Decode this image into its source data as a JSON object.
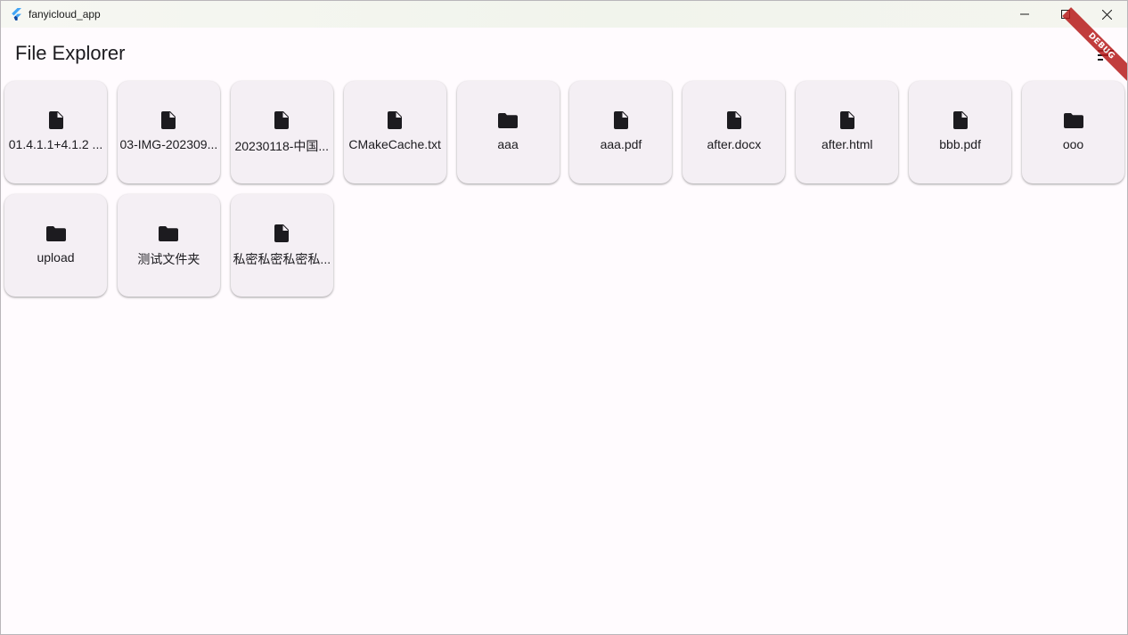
{
  "window": {
    "title": "fanyicloud_app"
  },
  "appbar": {
    "title": "File Explorer",
    "sort_icon": "sort-icon"
  },
  "debug_banner": "DEBUG",
  "files": [
    {
      "name": "01.4.1.1+4.1.2 ...",
      "type": "file"
    },
    {
      "name": "03-IMG-202309...",
      "type": "file"
    },
    {
      "name": "20230118-中国...",
      "type": "file"
    },
    {
      "name": "CMakeCache.txt",
      "type": "file"
    },
    {
      "name": "aaa",
      "type": "folder"
    },
    {
      "name": "aaa.pdf",
      "type": "file"
    },
    {
      "name": "after.docx",
      "type": "file"
    },
    {
      "name": "after.html",
      "type": "file"
    },
    {
      "name": "bbb.pdf",
      "type": "file"
    },
    {
      "name": "ooo",
      "type": "folder"
    },
    {
      "name": "upload",
      "type": "folder"
    },
    {
      "name": "测试文件夹",
      "type": "folder"
    },
    {
      "name": "私密私密私密私...",
      "type": "file"
    }
  ],
  "colors": {
    "tile_bg": "#f4eff4",
    "page_bg": "#fffbfe",
    "icon": "#1c1b1f",
    "debug": "#b71c1c"
  }
}
